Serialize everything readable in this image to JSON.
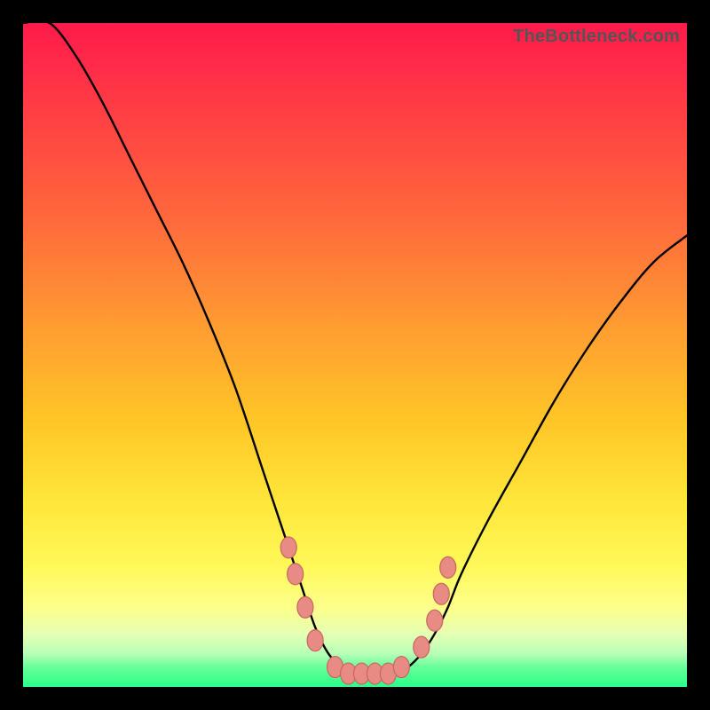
{
  "watermark": "TheBottleneck.com",
  "colors": {
    "frame": "#000000",
    "gradient_top": "#ff1a4b",
    "gradient_mid": "#ffc627",
    "gradient_bottom": "#2bff8a",
    "curve": "#000000",
    "marker_fill": "#e98b85",
    "marker_stroke": "#c9655f"
  },
  "chart_data": {
    "type": "line",
    "title": "",
    "xlabel": "",
    "ylabel": "",
    "xlim": [
      0,
      100
    ],
    "ylim": [
      0,
      100
    ],
    "note": "V-shaped bottleneck curve. y≈100 means severe bottleneck (top/red), y≈0 means no bottleneck (bottom/green). Left branch descends from top-left into the flat trough near x≈45–60, right branch rises toward ~(100, 68). Values estimated from pixel position against the 0–100 gradient bands.",
    "series": [
      {
        "name": "bottleneck-curve",
        "x": [
          0,
          4,
          8,
          12,
          16,
          20,
          24,
          28,
          32,
          36,
          38,
          40,
          42,
          44,
          46,
          48,
          50,
          52,
          54,
          56,
          58,
          60,
          62,
          64,
          66,
          70,
          75,
          80,
          85,
          90,
          95,
          100
        ],
        "y": [
          100,
          100,
          95,
          88,
          80,
          72,
          64,
          55,
          45,
          33,
          27,
          21,
          15,
          9,
          5,
          3,
          2,
          2,
          2,
          2,
          3,
          5,
          8,
          12,
          17,
          25,
          34,
          43,
          51,
          58,
          64,
          68
        ]
      }
    ],
    "markers": {
      "name": "trough-markers",
      "note": "Pink oval markers clustered around the trough of the curve.",
      "points": [
        {
          "x": 40,
          "y": 21
        },
        {
          "x": 41,
          "y": 17
        },
        {
          "x": 42.5,
          "y": 12
        },
        {
          "x": 44,
          "y": 7
        },
        {
          "x": 47,
          "y": 3
        },
        {
          "x": 49,
          "y": 2
        },
        {
          "x": 51,
          "y": 2
        },
        {
          "x": 53,
          "y": 2
        },
        {
          "x": 55,
          "y": 2
        },
        {
          "x": 57,
          "y": 3
        },
        {
          "x": 60,
          "y": 6
        },
        {
          "x": 62,
          "y": 10
        },
        {
          "x": 63,
          "y": 14
        },
        {
          "x": 64,
          "y": 18
        }
      ]
    }
  }
}
